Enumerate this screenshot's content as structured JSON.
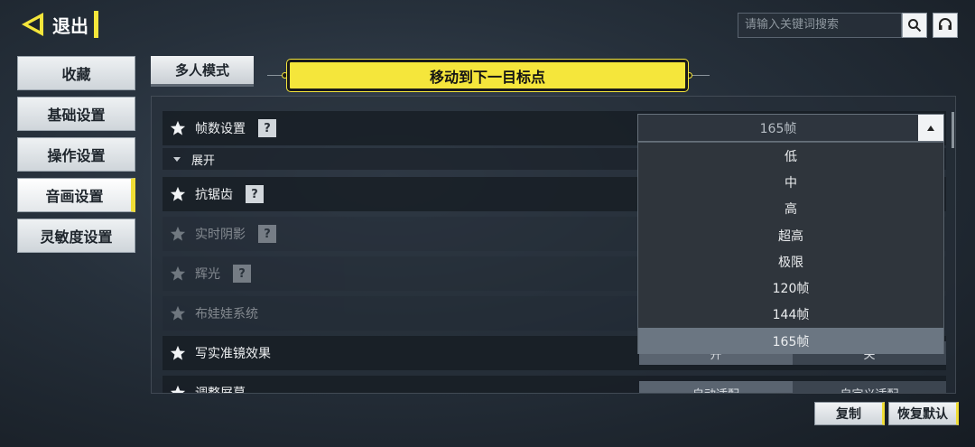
{
  "header": {
    "exit_label": "退出",
    "search_placeholder": "请输入关键词搜索"
  },
  "sidebar": {
    "items": [
      {
        "label": "收藏"
      },
      {
        "label": "基础设置"
      },
      {
        "label": "操作设置"
      },
      {
        "label": "音画设置",
        "active": true
      },
      {
        "label": "灵敏度设置"
      }
    ]
  },
  "tab": {
    "label": "多人模式"
  },
  "banner": {
    "label": "移动到下一目标点"
  },
  "settings": {
    "frame_rate": {
      "label": "帧数设置",
      "help": "?"
    },
    "expand": {
      "label": "展开"
    },
    "anti_aliasing": {
      "label": "抗锯齿",
      "help": "?"
    },
    "realtime_shadow": {
      "label": "实时阴影",
      "help": "?"
    },
    "bloom": {
      "label": "辉光",
      "help": "?"
    },
    "ragdoll": {
      "label": "布娃娃系统"
    },
    "scope_effect": {
      "label": "写实准镜效果",
      "opt_on": "开",
      "opt_off": "关"
    },
    "adjust_screen": {
      "label": "调整屏幕",
      "opt_a": "自动适配",
      "opt_b": "自定义适配"
    }
  },
  "dropdown": {
    "selected": "165帧",
    "options": [
      "低",
      "中",
      "高",
      "超高",
      "极限",
      "120帧",
      "144帧",
      "165帧"
    ]
  },
  "buttons": {
    "copy": "复制",
    "reset": "恢复默认"
  },
  "colors": {
    "accent": "#f5e63b",
    "panel": "#1c232b"
  }
}
